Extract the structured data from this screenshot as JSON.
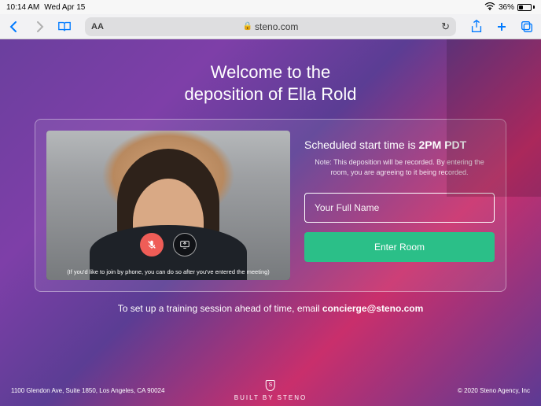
{
  "status": {
    "time": "10:14 AM",
    "date": "Wed Apr 15",
    "battery_pct": "36%"
  },
  "browser": {
    "aa_label": "AA",
    "url": "steno.com"
  },
  "page": {
    "heading_line1": "Welcome to the",
    "heading_line2": "deposition of Ella Rold",
    "scheduled_prefix": "Scheduled start time is ",
    "scheduled_time": "2PM PDT",
    "recording_note": "Note: This deposition will be recorded. By entering the room, you are agreeing to it being recorded.",
    "name_placeholder": "Your Full Name",
    "enter_button": "Enter Room",
    "video_note": "(If you'd like to join by phone, you can do so after you've entered the meeting)",
    "training_text": "To set up a training session ahead of time, email ",
    "training_email": "concierge@steno.com"
  },
  "footer": {
    "address": "1100 Glendon Ave, Suite 1850, Los Angeles, CA 90024",
    "brand": "BUILT BY STENO",
    "shield_letter": "S",
    "copyright": "© 2020 Steno Agency, Inc"
  }
}
